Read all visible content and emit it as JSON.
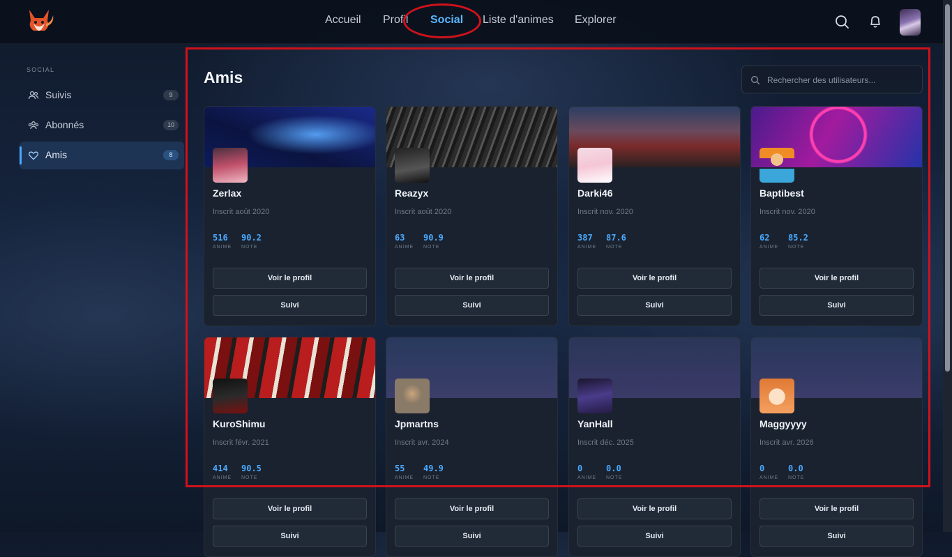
{
  "nav": {
    "links": [
      {
        "label": "Accueil"
      },
      {
        "label": "Profil"
      },
      {
        "label": "Social"
      },
      {
        "label": "Liste d'animes"
      },
      {
        "label": "Explorer"
      }
    ],
    "active": "Social"
  },
  "sidebar": {
    "section_title": "SOCIAL",
    "items": [
      {
        "label": "Suivis",
        "count": "9",
        "icon": "users-icon"
      },
      {
        "label": "Abonnés",
        "count": "10",
        "icon": "followers-icon"
      },
      {
        "label": "Amis",
        "count": "8",
        "icon": "heart-icon"
      }
    ]
  },
  "main": {
    "title": "Amis",
    "search": {
      "placeholder": "Rechercher des utilisateurs..."
    },
    "stat_labels": {
      "anime": "ANIME",
      "note": "NOTE"
    },
    "view_profile_label": "Voir le profil",
    "follow_label": "Suivi",
    "friends": [
      {
        "name": "Zerlax",
        "joined": "Inscrit août 2020",
        "anime": "516",
        "note": "90.2"
      },
      {
        "name": "Reazyx",
        "joined": "Inscrit août 2020",
        "anime": "63",
        "note": "90.9"
      },
      {
        "name": "Darki46",
        "joined": "Inscrit nov. 2020",
        "anime": "387",
        "note": "87.6"
      },
      {
        "name": "Baptibest",
        "joined": "Inscrit nov. 2020",
        "anime": "62",
        "note": "85.2"
      },
      {
        "name": "KuroShimu",
        "joined": "Inscrit févr. 2021",
        "anime": "414",
        "note": "90.5"
      },
      {
        "name": "Jpmartns",
        "joined": "Inscrit avr. 2024",
        "anime": "55",
        "note": "49.9"
      },
      {
        "name": "YanHall",
        "joined": "Inscrit déc. 2025",
        "anime": "0",
        "note": "0.0"
      },
      {
        "name": "Maggyyyy",
        "joined": "Inscrit avr. 2026",
        "anime": "0",
        "note": "0.0"
      }
    ]
  },
  "colors": {
    "accent": "#4aa9ff",
    "highlight": "#d0121b",
    "card": "#1a222f"
  }
}
